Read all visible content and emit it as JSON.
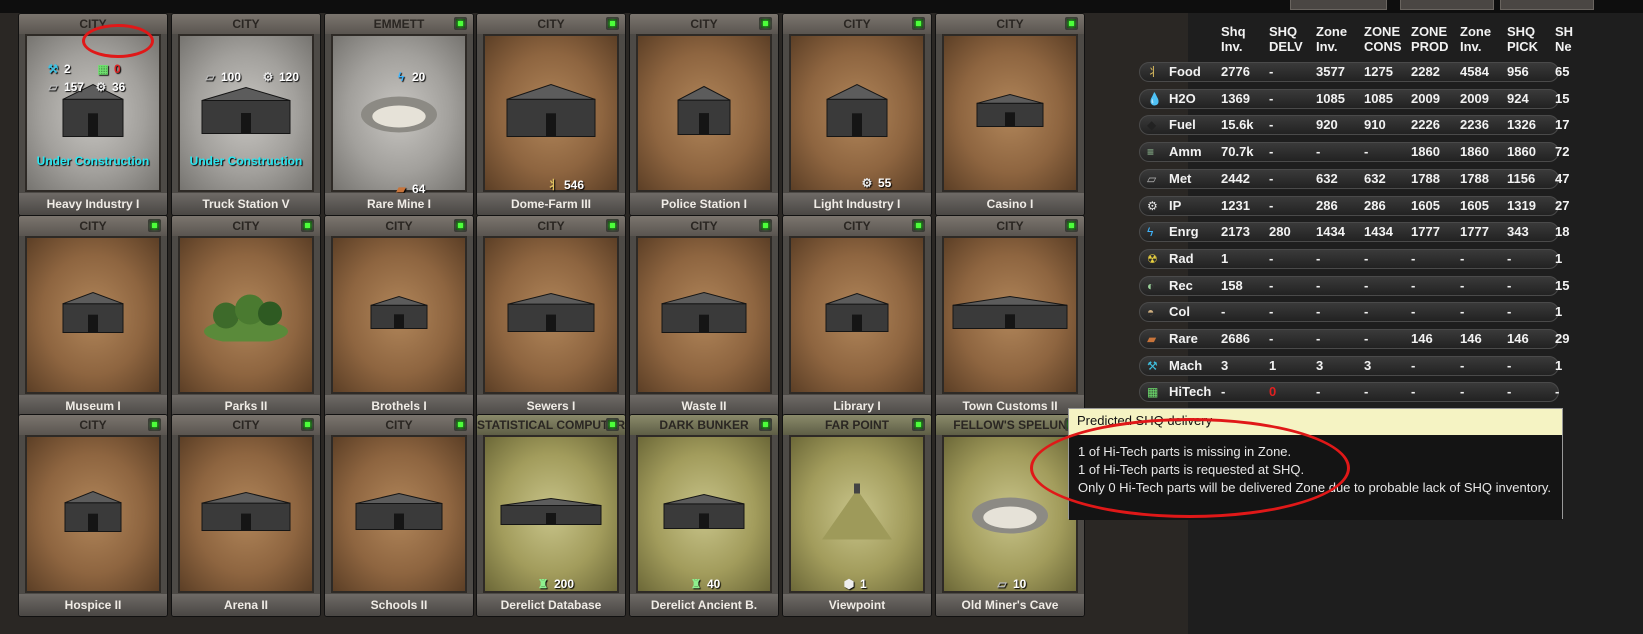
{
  "topbar": {},
  "cards": [
    {
      "header": "CITY",
      "name": "Heavy Industry I",
      "status": "Under Construction",
      "stats": [
        {
          "icon": "machinery-icon",
          "value": "2"
        },
        {
          "icon": "hitech-icon",
          "value": "0"
        },
        {
          "icon": "metal-icon",
          "value": "157"
        },
        {
          "icon": "ip-gear-icon",
          "value": "36"
        }
      ]
    },
    {
      "header": "CITY",
      "name": "Truck Station V",
      "status": "Under Construction",
      "stats": [
        {
          "icon": "metal-icon",
          "value": "100"
        },
        {
          "icon": "ip-gear-icon",
          "value": "120"
        }
      ]
    },
    {
      "header": "EMMETT",
      "name": "Rare Mine I",
      "stats": [
        {
          "icon": "energy-icon",
          "value": "20"
        },
        {
          "icon": "rare-icon",
          "value": "64"
        }
      ]
    },
    {
      "header": "CITY",
      "name": "Dome-Farm III",
      "stats": [
        {
          "icon": "food-icon",
          "value": "546"
        }
      ]
    },
    {
      "header": "CITY",
      "name": "Police Station I",
      "stats": []
    },
    {
      "header": "CITY",
      "name": "Light Industry I",
      "stats": [
        {
          "icon": "ip-gear-icon",
          "value": "55"
        }
      ]
    },
    {
      "header": "CITY",
      "name": "Casino I",
      "stats": []
    },
    {
      "header": "CITY",
      "name": "Museum I",
      "stats": []
    },
    {
      "header": "CITY",
      "name": "Parks II",
      "stats": []
    },
    {
      "header": "CITY",
      "name": "Brothels I",
      "stats": []
    },
    {
      "header": "CITY",
      "name": "Sewers I",
      "stats": []
    },
    {
      "header": "CITY",
      "name": "Waste II",
      "stats": []
    },
    {
      "header": "CITY",
      "name": "Library I",
      "stats": []
    },
    {
      "header": "CITY",
      "name": "Town Customs II",
      "stats": []
    },
    {
      "header": "CITY",
      "name": "Hospice II",
      "stats": []
    },
    {
      "header": "CITY",
      "name": "Arena II",
      "stats": []
    },
    {
      "header": "CITY",
      "name": "Schools II",
      "stats": []
    },
    {
      "header": "STATISTICAL COMPUTER",
      "name": "Derelict Database",
      "stats": [
        {
          "icon": "tower-icon",
          "value": "200"
        }
      ]
    },
    {
      "header": "DARK BUNKER",
      "name": "Derelict Ancient B.",
      "stats": [
        {
          "icon": "tower-icon",
          "value": "40"
        }
      ]
    },
    {
      "header": "FAR POINT",
      "name": "Viewpoint",
      "stats": [
        {
          "icon": "hexagon-icon",
          "value": "1"
        }
      ]
    },
    {
      "header": "FELLOW'S SPELUN",
      "name": "Old Miner's Cave",
      "stats": [
        {
          "icon": "metal-icon",
          "value": "10"
        }
      ]
    }
  ],
  "table": {
    "headers": [
      {
        "l1": "Shq",
        "l2": "Inv."
      },
      {
        "l1": "SHQ",
        "l2": "DELV"
      },
      {
        "l1": "Zone",
        "l2": "Inv."
      },
      {
        "l1": "ZONE",
        "l2": "CONS"
      },
      {
        "l1": "ZONE",
        "l2": "PROD"
      },
      {
        "l1": "Zone",
        "l2": "Inv."
      },
      {
        "l1": "SHQ",
        "l2": "PICK"
      },
      {
        "l1": "SH",
        "l2": "Ne"
      }
    ],
    "rows": [
      {
        "name": "Food",
        "icon": "food-icon",
        "cells": [
          "2776",
          "-",
          "3577",
          "1275",
          "2282",
          "4584",
          "956",
          "65"
        ]
      },
      {
        "name": "H2O",
        "icon": "water-drop-icon",
        "cells": [
          "1369",
          "-",
          "1085",
          "1085",
          "2009",
          "2009",
          "924",
          "15"
        ]
      },
      {
        "name": "Fuel",
        "icon": "fuel-drop-icon",
        "cells": [
          "15.6k",
          "-",
          "920",
          "910",
          "2226",
          "2236",
          "1326",
          "17"
        ]
      },
      {
        "name": "Amm",
        "icon": "ammo-icon",
        "cells": [
          "70.7k",
          "-",
          "-",
          "-",
          "1860",
          "1860",
          "1860",
          "72"
        ]
      },
      {
        "name": "Met",
        "icon": "metal-icon",
        "cells": [
          "2442",
          "-",
          "632",
          "632",
          "1788",
          "1788",
          "1156",
          "47"
        ]
      },
      {
        "name": "IP",
        "icon": "ip-gear-icon",
        "cells": [
          "1231",
          "-",
          "286",
          "286",
          "1605",
          "1605",
          "1319",
          "27"
        ]
      },
      {
        "name": "Enrg",
        "icon": "energy-icon",
        "cells": [
          "2173",
          "280",
          "1434",
          "1434",
          "1777",
          "1777",
          "343",
          "18"
        ]
      },
      {
        "name": "Rad",
        "icon": "radiation-icon",
        "cells": [
          "1",
          "-",
          "-",
          "-",
          "-",
          "-",
          "-",
          "1"
        ]
      },
      {
        "name": "Rec",
        "icon": "recruit-icon",
        "cells": [
          "158",
          "-",
          "-",
          "-",
          "-",
          "-",
          "-",
          "15"
        ]
      },
      {
        "name": "Col",
        "icon": "colonist-icon",
        "cells": [
          "-",
          "-",
          "-",
          "-",
          "-",
          "-",
          "-",
          "1"
        ]
      },
      {
        "name": "Rare",
        "icon": "rare-icon",
        "cells": [
          "2686",
          "-",
          "-",
          "-",
          "146",
          "146",
          "146",
          "29"
        ]
      },
      {
        "name": "Mach",
        "icon": "machinery-icon",
        "cells": [
          "3",
          "1",
          "3",
          "3",
          "-",
          "-",
          "-",
          "1"
        ]
      },
      {
        "name": "HiTech",
        "icon": "hitech-icon",
        "cells": [
          "-",
          "0",
          "-",
          "-",
          "-",
          "-",
          "-",
          "-"
        ]
      }
    ]
  },
  "tooltip": {
    "title": "Predicted SHQ delivery",
    "lines": [
      "1 of Hi-Tech parts is missing in Zone.",
      "1 of Hi-Tech parts is requested at SHQ.",
      "Only 0 Hi-Tech parts will be delivered Zone due to probable lack of SHQ inventory."
    ]
  },
  "colors": {
    "accent_cyan": "#2ae6f0",
    "warning_red": "#e02020",
    "led_green": "#4cff3a",
    "annotation_red": "#e01818"
  }
}
